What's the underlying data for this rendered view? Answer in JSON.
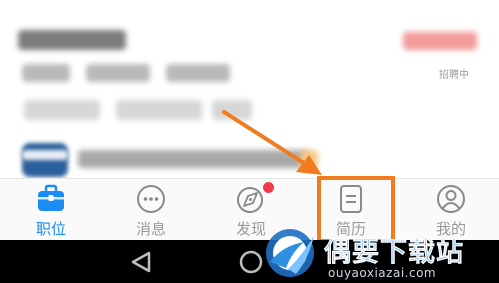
{
  "job_card": {
    "status_text": "招聘中"
  },
  "tabs": [
    {
      "label": "职位",
      "icon": "briefcase-icon",
      "active": true
    },
    {
      "label": "消息",
      "icon": "chat-bubble-icon",
      "active": false
    },
    {
      "label": "发现",
      "icon": "discover-icon",
      "active": false,
      "has_badge_dot": true
    },
    {
      "label": "简历",
      "icon": "resume-icon",
      "active": false,
      "highlighted": true
    },
    {
      "label": "我的",
      "icon": "profile-icon",
      "active": false
    }
  ],
  "system_nav": {
    "icons": [
      "back-icon",
      "home-icon"
    ]
  },
  "watermark": {
    "title": "偶要下载站",
    "url": "ouyaoxiazai.com"
  },
  "colors": {
    "active_tab": "#1a8cf2",
    "inactive_tab": "#9a9a9a",
    "highlight_box": "#f07c1f",
    "arrow": "#f07c1f",
    "badge_dot": "#f0394a",
    "watermark_blue": "#2f8fe3"
  }
}
